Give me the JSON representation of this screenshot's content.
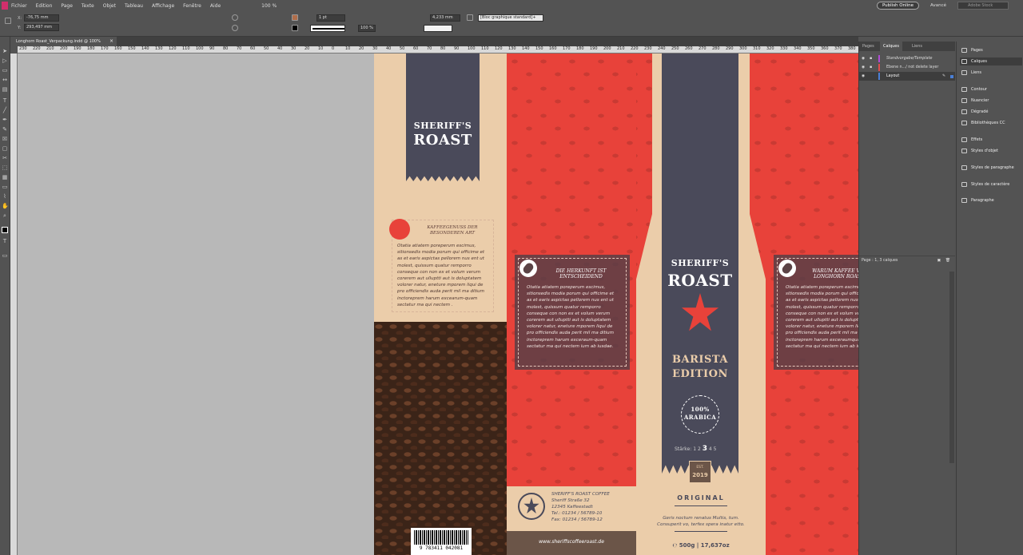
{
  "menu": [
    "Fichier",
    "Edition",
    "Page",
    "Texte",
    "Objet",
    "Tableau",
    "Affichage",
    "Fenêtre",
    "Aide"
  ],
  "zoom": "100 %",
  "publish_label": "Publish Online",
  "workspace": "Avancé",
  "stock_placeholder": "Adobe Stock",
  "control": {
    "x": "-76,75 mm",
    "y": "293,497 mm",
    "stroke_weight": "1 pt",
    "opacity": "100 %",
    "size": "4,233 mm",
    "style": "[Bloc graphique standard]+"
  },
  "doc_tab": "Longhorn Roast_Verpackung.indd @ 100%",
  "ruler_ticks": [
    "230",
    "220",
    "210",
    "200",
    "190",
    "180",
    "170",
    "160",
    "150",
    "140",
    "130",
    "120",
    "110",
    "100",
    "90",
    "80",
    "70",
    "60",
    "50",
    "40",
    "30",
    "20",
    "10",
    "0",
    "10",
    "20",
    "30",
    "40",
    "50",
    "60",
    "70",
    "80",
    "90",
    "100",
    "110",
    "120",
    "130",
    "140",
    "150",
    "160",
    "170",
    "180",
    "190",
    "200",
    "210",
    "220",
    "230",
    "240",
    "250",
    "260",
    "270",
    "280",
    "290",
    "300",
    "310",
    "320",
    "330",
    "340",
    "350",
    "360",
    "370",
    "380"
  ],
  "layers_panel": {
    "tabs": [
      "Pages",
      "Calques",
      "Liens"
    ],
    "layers": [
      "Standvorgabe/Template",
      "Ebene n.../ not delete layer",
      "Layout"
    ],
    "footer": "Page : 1, 3 calques"
  },
  "panel_list": [
    "Pages",
    "Calques",
    "Liens",
    "Contour",
    "Nuancier",
    "Dégradé",
    "Bibliothèques CC",
    "Effets",
    "Styles d'objet",
    "Styles de paragraphe",
    "Styles de caractère",
    "Paragraphe"
  ],
  "artwork": {
    "brand_line1": "SHERIFF'S",
    "brand_line2": "ROAST",
    "box1_title": "KAFFEEGENUSS DER BESONDEREN ART",
    "box1_body": "Otatia atiatem poreperum escimus, sitionsedis modia porum qui officime et as et earis aspictas pellorem nus ent ut molest, quissum quatur remporro conseque con non ex et volum verum corerem aut ulluptti aut is doluptatem volorer natur, eneture mporem liqui de pro officiendis auda perit mil ma ditium inctoreprem harum excearum-quam sectatur ma qui nectem .",
    "box2_title": "DIE HERKUNFT IST ENTSCHEIDEND",
    "box2_body": "Otatia atiatem poreperum escimus, sitionsedis modia porum qui officime et as et earis aspictas pellorem nus ent ut molest, quissum quatur remporro conseque con non ex et volum verum corerem aut ulluptti aut is doluptatem volorer natur, eneture mporem liqui de pro officiendis auda perit mil ma ditium inctoreprem harum exceraum-quam sectatur ma qui nectem ium ab iusdae.",
    "box3_title": "WARUM KAFFEE VON LONGHORN ROAST?",
    "box3_body": "Otatia atiatem poreperum escimus, sitionsedis modia porum qui officime et as et earis aspictas pellorem nus ent ut molest, quissum quatur remporro conseque con non ex et volum verum corerem aut ulluptti aut is doluptatem volorer natur, eneture mporem liqui de pro officiendis auda perit mil ma ditium inctoreprem harum exceraumquam sectatur ma qui nectem ium ab iusdae.",
    "edition_line1": "BARISTA",
    "edition_line2": "EDITION",
    "arabica_line1": "100%",
    "arabica_line2": "ARABICA",
    "strength_label": "Stärke:",
    "strength_values": [
      "1",
      "2",
      "3",
      "4",
      "5"
    ],
    "est_label": "EST.",
    "est_year": "2019",
    "original": "ORIGINAL",
    "tagline": "Geris noctum renatus Multis, tum. Consuperit vo, terfex spera inatur etto.",
    "weight": "℮ 500g | 17,637oz",
    "address": [
      "SHERIFF'S ROAST COFFEE",
      "Sheriff Straße 32",
      "12345 Kaffeestadt",
      "Tel.: 01234 / 56789-10",
      "Fax: 01234 / 56789-12"
    ],
    "website": "www.sheriffscoffeeroast.de",
    "barcode": "9 783411 042081"
  }
}
